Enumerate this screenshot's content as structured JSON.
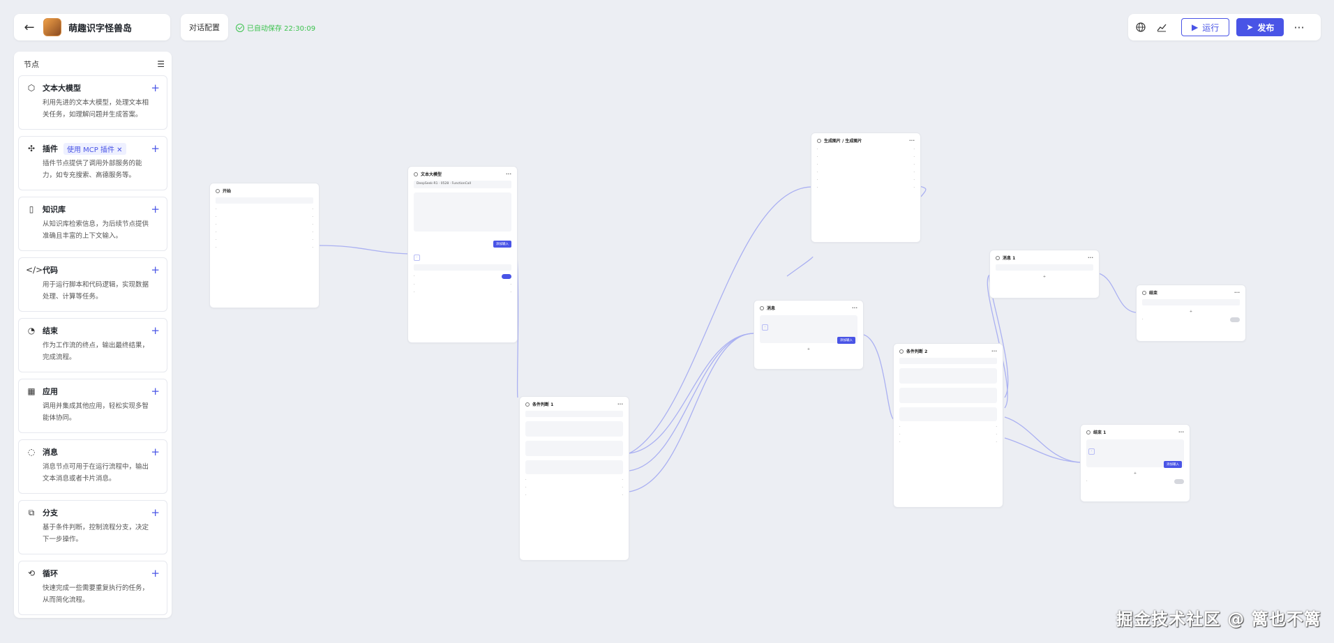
{
  "app": {
    "name": "萌趣识字怪兽岛",
    "dialog_config": "对话配置",
    "autosave": "已自动保存 22:30:09"
  },
  "toolbar": {
    "run_label": "运行",
    "publish_label": "发布"
  },
  "sidebar": {
    "title": "节点",
    "items": [
      {
        "icon": "cube-icon",
        "title": "文本大模型",
        "tag": "",
        "desc": "利用先进的文本大模型，处理文本相关任务，如理解问题并生成答案。"
      },
      {
        "icon": "puzzle-icon",
        "title": "插件",
        "tag": "使用 MCP 插件 ✕",
        "desc": "插件节点提供了调用外部服务的能力，如专充搜索、高德服务等。"
      },
      {
        "icon": "book-icon",
        "title": "知识库",
        "tag": "",
        "desc": "从知识库检索信息，为后续节点提供准确且丰富的上下文输入。"
      },
      {
        "icon": "code-icon",
        "title": "代码",
        "tag": "",
        "desc": "用于运行脚本和代码逻辑，实现数据处理、计算等任务。"
      },
      {
        "icon": "end-icon",
        "title": "结束",
        "tag": "",
        "desc": "作为工作流的终点，输出最终结果，完成流程。"
      },
      {
        "icon": "grid-icon",
        "title": "应用",
        "tag": "",
        "desc": "调用并集成其他应用，轻松实现多智能体协同。"
      },
      {
        "icon": "message-icon",
        "title": "消息",
        "tag": "",
        "desc": "消息节点可用于在运行流程中，输出文本消息或者卡片消息。"
      },
      {
        "icon": "branch-icon",
        "title": "分支",
        "tag": "",
        "desc": "基于条件判断，控制流程分支，决定下一步操作。"
      },
      {
        "icon": "loop-icon",
        "title": "循环",
        "tag": "",
        "desc": "快速完成一些需要重复执行的任务，从而简化流程。"
      }
    ]
  },
  "canvas": {
    "nodes": [
      {
        "id": "start",
        "title": "开始"
      },
      {
        "id": "llm",
        "title": "文本大模型",
        "model": "DeepSeek-R1 · 0528 · FunctionCall",
        "add_input": "添加输入"
      },
      {
        "id": "branch1",
        "title": "条件判断 1"
      },
      {
        "id": "msg_center",
        "title": "消息",
        "add_input": "添加输入"
      },
      {
        "id": "plugin_top",
        "title": "生成图片 / 生成图片"
      },
      {
        "id": "branch2",
        "title": "条件判断 2"
      },
      {
        "id": "msg1",
        "title": "消息 1"
      },
      {
        "id": "end_right",
        "title": "结束"
      },
      {
        "id": "end1",
        "title": "结束 1",
        "add_input": "添加输入"
      }
    ]
  },
  "watermark": "掘金技术社区 @ 篱也不篱"
}
